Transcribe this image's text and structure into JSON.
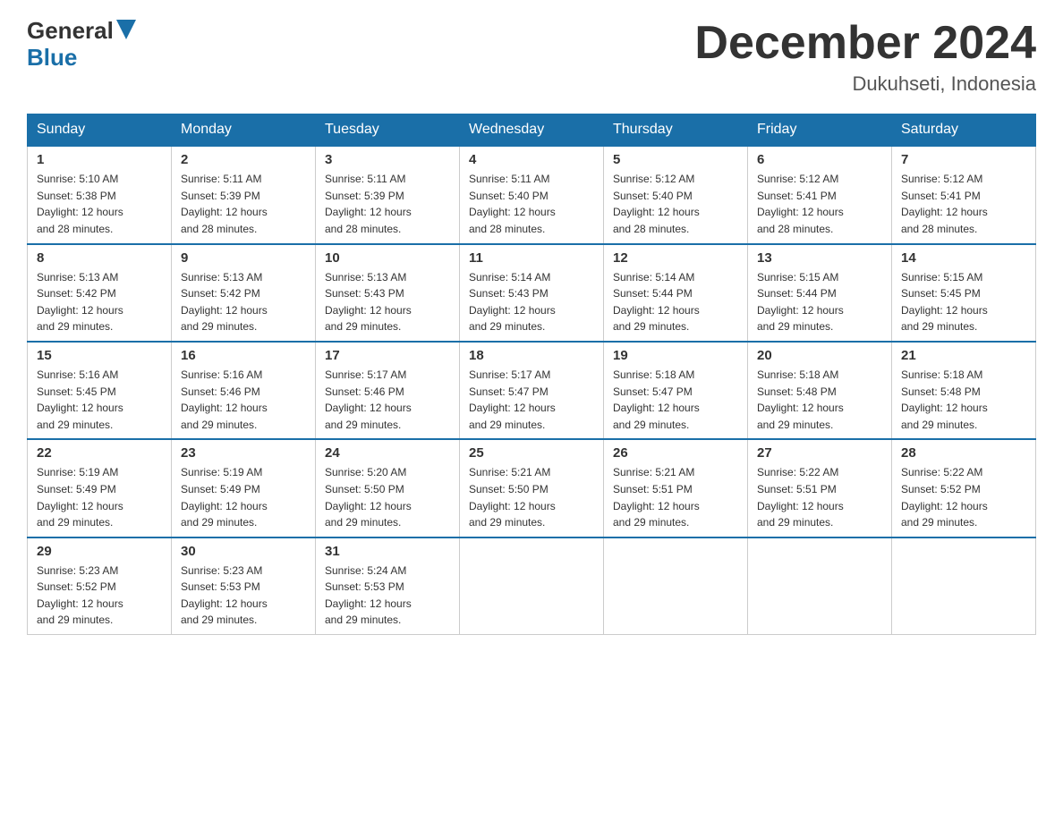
{
  "header": {
    "logo_general": "General",
    "logo_blue": "Blue",
    "month_title": "December 2024",
    "subtitle": "Dukuhseti, Indonesia"
  },
  "weekdays": [
    "Sunday",
    "Monday",
    "Tuesday",
    "Wednesday",
    "Thursday",
    "Friday",
    "Saturday"
  ],
  "weeks": [
    [
      {
        "day": "1",
        "sunrise": "5:10 AM",
        "sunset": "5:38 PM",
        "daylight": "12 hours and 28 minutes."
      },
      {
        "day": "2",
        "sunrise": "5:11 AM",
        "sunset": "5:39 PM",
        "daylight": "12 hours and 28 minutes."
      },
      {
        "day": "3",
        "sunrise": "5:11 AM",
        "sunset": "5:39 PM",
        "daylight": "12 hours and 28 minutes."
      },
      {
        "day": "4",
        "sunrise": "5:11 AM",
        "sunset": "5:40 PM",
        "daylight": "12 hours and 28 minutes."
      },
      {
        "day": "5",
        "sunrise": "5:12 AM",
        "sunset": "5:40 PM",
        "daylight": "12 hours and 28 minutes."
      },
      {
        "day": "6",
        "sunrise": "5:12 AM",
        "sunset": "5:41 PM",
        "daylight": "12 hours and 28 minutes."
      },
      {
        "day": "7",
        "sunrise": "5:12 AM",
        "sunset": "5:41 PM",
        "daylight": "12 hours and 28 minutes."
      }
    ],
    [
      {
        "day": "8",
        "sunrise": "5:13 AM",
        "sunset": "5:42 PM",
        "daylight": "12 hours and 29 minutes."
      },
      {
        "day": "9",
        "sunrise": "5:13 AM",
        "sunset": "5:42 PM",
        "daylight": "12 hours and 29 minutes."
      },
      {
        "day": "10",
        "sunrise": "5:13 AM",
        "sunset": "5:43 PM",
        "daylight": "12 hours and 29 minutes."
      },
      {
        "day": "11",
        "sunrise": "5:14 AM",
        "sunset": "5:43 PM",
        "daylight": "12 hours and 29 minutes."
      },
      {
        "day": "12",
        "sunrise": "5:14 AM",
        "sunset": "5:44 PM",
        "daylight": "12 hours and 29 minutes."
      },
      {
        "day": "13",
        "sunrise": "5:15 AM",
        "sunset": "5:44 PM",
        "daylight": "12 hours and 29 minutes."
      },
      {
        "day": "14",
        "sunrise": "5:15 AM",
        "sunset": "5:45 PM",
        "daylight": "12 hours and 29 minutes."
      }
    ],
    [
      {
        "day": "15",
        "sunrise": "5:16 AM",
        "sunset": "5:45 PM",
        "daylight": "12 hours and 29 minutes."
      },
      {
        "day": "16",
        "sunrise": "5:16 AM",
        "sunset": "5:46 PM",
        "daylight": "12 hours and 29 minutes."
      },
      {
        "day": "17",
        "sunrise": "5:17 AM",
        "sunset": "5:46 PM",
        "daylight": "12 hours and 29 minutes."
      },
      {
        "day": "18",
        "sunrise": "5:17 AM",
        "sunset": "5:47 PM",
        "daylight": "12 hours and 29 minutes."
      },
      {
        "day": "19",
        "sunrise": "5:18 AM",
        "sunset": "5:47 PM",
        "daylight": "12 hours and 29 minutes."
      },
      {
        "day": "20",
        "sunrise": "5:18 AM",
        "sunset": "5:48 PM",
        "daylight": "12 hours and 29 minutes."
      },
      {
        "day": "21",
        "sunrise": "5:18 AM",
        "sunset": "5:48 PM",
        "daylight": "12 hours and 29 minutes."
      }
    ],
    [
      {
        "day": "22",
        "sunrise": "5:19 AM",
        "sunset": "5:49 PM",
        "daylight": "12 hours and 29 minutes."
      },
      {
        "day": "23",
        "sunrise": "5:19 AM",
        "sunset": "5:49 PM",
        "daylight": "12 hours and 29 minutes."
      },
      {
        "day": "24",
        "sunrise": "5:20 AM",
        "sunset": "5:50 PM",
        "daylight": "12 hours and 29 minutes."
      },
      {
        "day": "25",
        "sunrise": "5:21 AM",
        "sunset": "5:50 PM",
        "daylight": "12 hours and 29 minutes."
      },
      {
        "day": "26",
        "sunrise": "5:21 AM",
        "sunset": "5:51 PM",
        "daylight": "12 hours and 29 minutes."
      },
      {
        "day": "27",
        "sunrise": "5:22 AM",
        "sunset": "5:51 PM",
        "daylight": "12 hours and 29 minutes."
      },
      {
        "day": "28",
        "sunrise": "5:22 AM",
        "sunset": "5:52 PM",
        "daylight": "12 hours and 29 minutes."
      }
    ],
    [
      {
        "day": "29",
        "sunrise": "5:23 AM",
        "sunset": "5:52 PM",
        "daylight": "12 hours and 29 minutes."
      },
      {
        "day": "30",
        "sunrise": "5:23 AM",
        "sunset": "5:53 PM",
        "daylight": "12 hours and 29 minutes."
      },
      {
        "day": "31",
        "sunrise": "5:24 AM",
        "sunset": "5:53 PM",
        "daylight": "12 hours and 29 minutes."
      },
      null,
      null,
      null,
      null
    ]
  ],
  "labels": {
    "sunrise": "Sunrise:",
    "sunset": "Sunset:",
    "daylight": "Daylight:"
  }
}
